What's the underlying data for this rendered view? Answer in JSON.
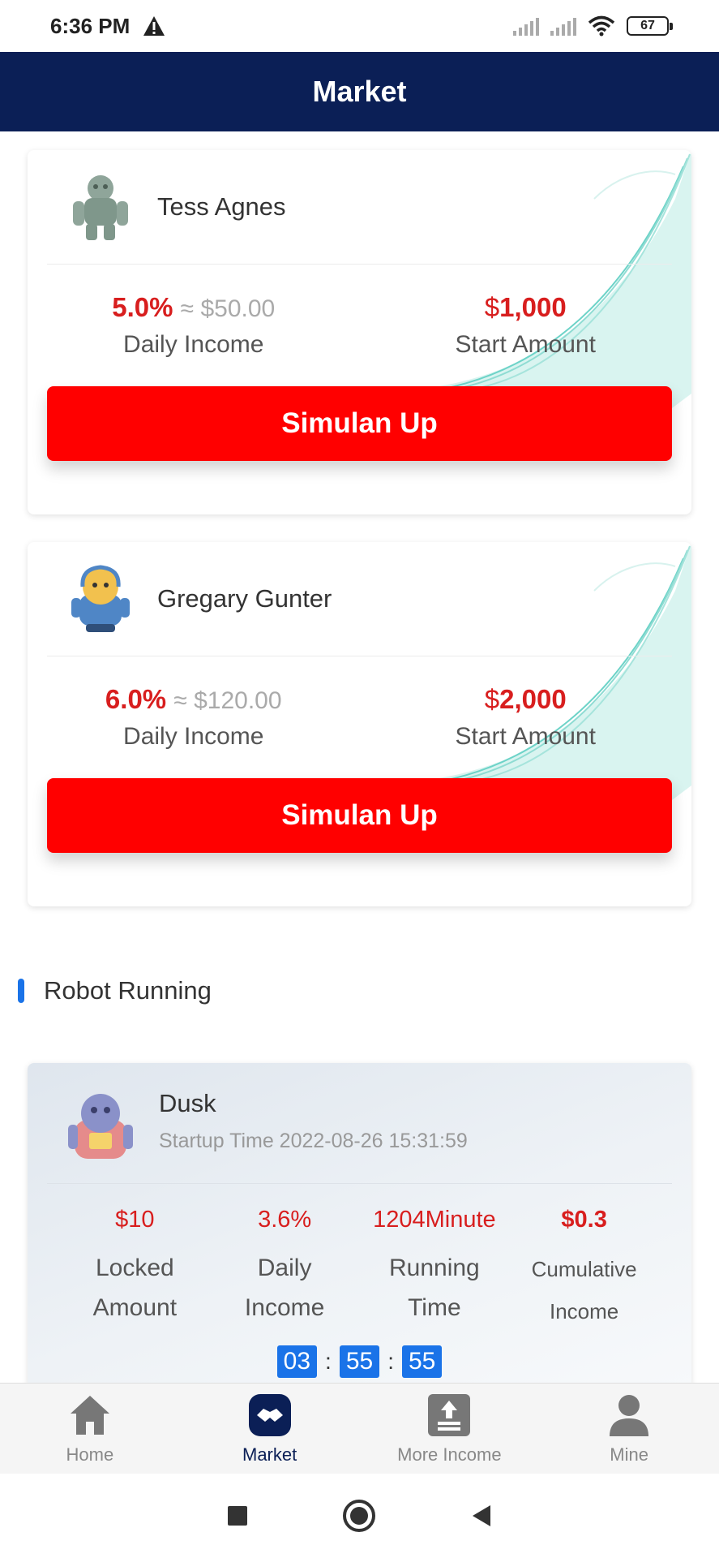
{
  "status_bar": {
    "time": "6:36 PM",
    "battery": "67"
  },
  "header": {
    "title": "Market"
  },
  "robots": [
    {
      "name": "Tess Agnes",
      "rate": "5.0%",
      "approx": "≈ $50.00",
      "currency": "$",
      "start_amount": "1,000",
      "daily_label": "Daily Income",
      "start_label": "Start Amount",
      "button": "Simulan Up"
    },
    {
      "name": "Gregary Gunter",
      "rate": "6.0%",
      "approx": "≈ $120.00",
      "currency": "$",
      "start_amount": "2,000",
      "daily_label": "Daily Income",
      "start_label": "Start Amount",
      "button": "Simulan Up"
    }
  ],
  "section": {
    "title": "Robot Running"
  },
  "running": {
    "name": "Dusk",
    "startup": "Startup Time 2022-08-26 15:31:59",
    "stats": [
      {
        "value": "$10",
        "label_1": "Locked",
        "label_2": "Amount"
      },
      {
        "value": "3.6%",
        "label_1": "Daily",
        "label_2": "Income"
      },
      {
        "value": "1204Minute",
        "label_1": "Running",
        "label_2": "Time"
      },
      {
        "value": "$0.3",
        "label_1": "Cumulative",
        "label_2": "Income"
      }
    ],
    "timer": {
      "hours": "03",
      "minutes": "55",
      "seconds": "55",
      "sep": ":"
    }
  },
  "nav": {
    "items": [
      {
        "label": "Home",
        "icon": "home-icon"
      },
      {
        "label": "Market",
        "icon": "handshake-icon"
      },
      {
        "label": "More Income",
        "icon": "upload-money-icon"
      },
      {
        "label": "Mine",
        "icon": "person-icon"
      }
    ],
    "active": "Market"
  },
  "colors": {
    "header": "#0b1f56",
    "accent_red": "#ff0000",
    "value_red": "#d81e1e",
    "accent_blue": "#1a73e8"
  }
}
